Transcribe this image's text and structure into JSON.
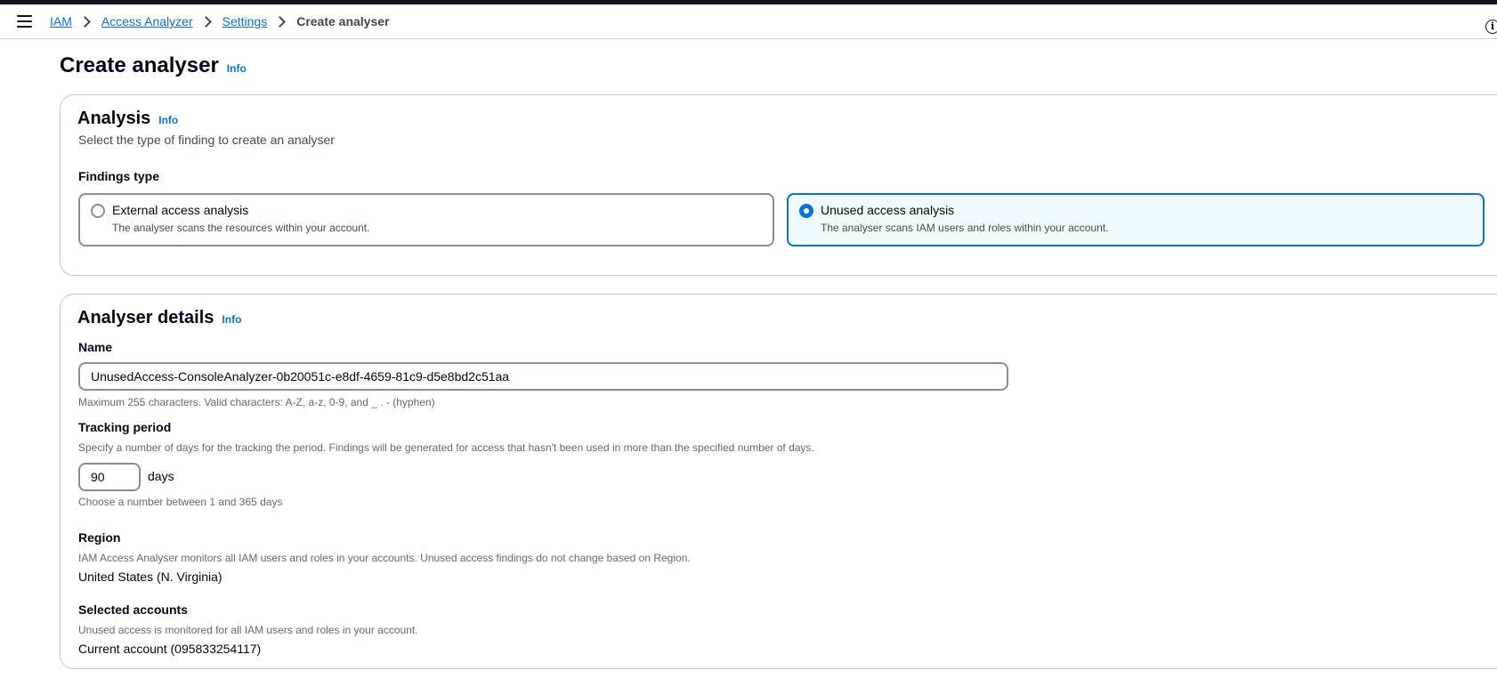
{
  "breadcrumb": {
    "items": [
      "IAM",
      "Access Analyzer",
      "Settings"
    ],
    "current": "Create analyser"
  },
  "page": {
    "title": "Create analyser",
    "info": "Info"
  },
  "analysis": {
    "header": "Analysis",
    "info": "Info",
    "description": "Select the type of finding to create an analyser",
    "findings_label": "Findings type",
    "options": [
      {
        "title": "External access analysis",
        "description": "The analyser scans the resources within your account.",
        "selected": false
      },
      {
        "title": "Unused access analysis",
        "description": "The analyser scans IAM users and roles within your account.",
        "selected": true
      }
    ]
  },
  "details": {
    "header": "Analyser details",
    "info": "Info",
    "name_label": "Name",
    "name_value": "UnusedAccess-ConsoleAnalyzer-0b20051c-e8df-4659-81c9-d5e8bd2c51aa",
    "name_hint": "Maximum 255 characters. Valid characters: A-Z, a-z, 0-9, and _ . - (hyphen)",
    "tracking_label": "Tracking period",
    "tracking_desc": "Specify a number of days for the tracking the period. Findings will be generated for access that hasn't been used in more than the specified number of days.",
    "tracking_value": "90",
    "tracking_unit": "days",
    "tracking_hint": "Choose a number between 1 and 365 days",
    "region_label": "Region",
    "region_desc": "IAM Access Analyser monitors all IAM users and roles in your accounts. Unused access findings do not change based on Region.",
    "region_value": "United States (N. Virginia)",
    "accounts_label": "Selected accounts",
    "accounts_desc": "Unused access is monitored for all IAM users and roles in your account.",
    "accounts_value": "Current account (095833254117)"
  },
  "colors": {
    "link": "#0972d3",
    "selected_tile_bg": "#f0fbff",
    "text": "#000716"
  }
}
